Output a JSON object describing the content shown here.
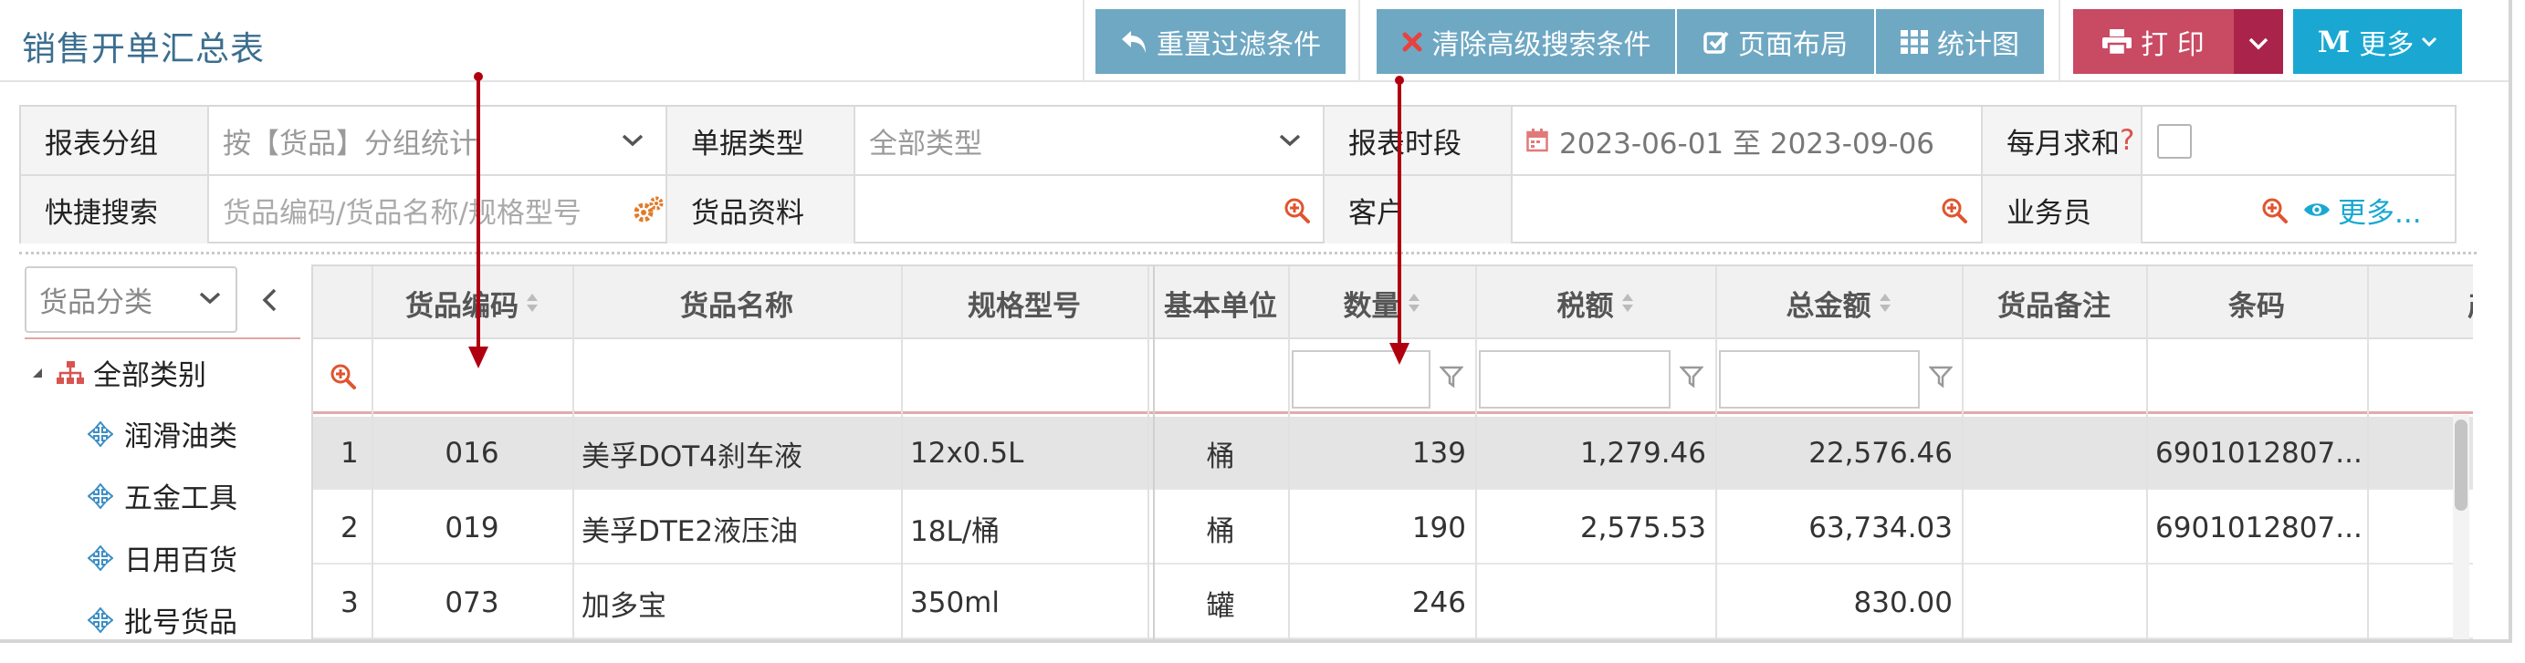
{
  "header": {
    "title": "销售开单汇总表",
    "buttons": {
      "reset_filter": "重置过滤条件",
      "clear_advanced": "清除高级搜索条件",
      "page_layout": "页面布局",
      "chart": "统计图",
      "print": "打 印",
      "more": "更多"
    }
  },
  "filters": {
    "report_group_label": "报表分组",
    "report_group_value": "按【货品】分组统计",
    "doc_type_label": "单据类型",
    "doc_type_value": "全部类型",
    "period_label": "报表时段",
    "period_value": "2023-06-01 至 2023-09-06",
    "monthly_sum_label": "每月求和",
    "monthly_sum_help": "?",
    "quick_search_label": "快捷搜索",
    "quick_search_placeholder": "货品编码/货品名称/规格型号",
    "goods_label": "货品资料",
    "customer_label": "客户",
    "salesman_label": "业务员",
    "more_link": "更多..."
  },
  "tree": {
    "select_label": "货品分类",
    "root": "全部类别",
    "items": [
      "润滑油类",
      "五金工具",
      "日用百货",
      "批号货品"
    ]
  },
  "grid": {
    "columns": [
      "货品编码",
      "货品名称",
      "规格型号",
      "基本单位",
      "数量",
      "税额",
      "总金额",
      "货品备注",
      "条码",
      "产"
    ],
    "rows": [
      {
        "no": "1",
        "code": "016",
        "name": "美孚DOT4刹车液",
        "spec": "12x0.5L",
        "unit": "桶",
        "qty": "139",
        "tax": "1,279.46",
        "total": "22,576.46",
        "remark": "",
        "barcode": "6901012807..."
      },
      {
        "no": "2",
        "code": "019",
        "name": "美孚DTE2液压油",
        "spec": "18L/桶",
        "unit": "桶",
        "qty": "190",
        "tax": "2,575.53",
        "total": "63,734.03",
        "remark": "",
        "barcode": "6901012807..."
      },
      {
        "no": "3",
        "code": "073",
        "name": "加多宝",
        "spec": "350ml",
        "unit": "罐",
        "qty": "246",
        "tax": "",
        "total": "830.00",
        "remark": "",
        "barcode": ""
      }
    ]
  },
  "colors": {
    "accent_teal": "#6fa8c3",
    "print_red": "#c94a63",
    "more_cyan": "#1aa8d2",
    "title_blue": "#3b6e8f",
    "tree_icon_blue": "#3d8fc4",
    "annotation_red": "#b00010"
  }
}
